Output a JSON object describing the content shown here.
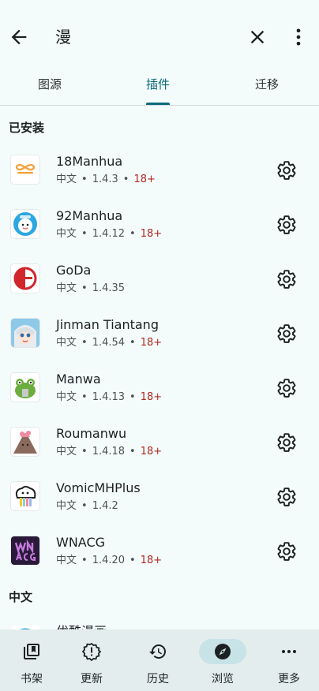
{
  "search": {
    "query": "漫"
  },
  "tabs": [
    {
      "label": "图源"
    },
    {
      "label": "插件"
    },
    {
      "label": "迁移"
    }
  ],
  "sections": {
    "installed": "已安装",
    "chinese": "中文"
  },
  "extensions": [
    {
      "name": "18Manhua",
      "lang": "中文",
      "version": "1.4.3",
      "nsfw": "18+"
    },
    {
      "name": "92Manhua",
      "lang": "中文",
      "version": "1.4.12",
      "nsfw": "18+"
    },
    {
      "name": "GoDa",
      "lang": "中文",
      "version": "1.4.35",
      "nsfw": ""
    },
    {
      "name": "Jinman Tiantang",
      "lang": "中文",
      "version": "1.4.54",
      "nsfw": "18+"
    },
    {
      "name": "Manwa",
      "lang": "中文",
      "version": "1.4.13",
      "nsfw": "18+"
    },
    {
      "name": "Roumanwu",
      "lang": "中文",
      "version": "1.4.18",
      "nsfw": "18+"
    },
    {
      "name": "VomicMHPlus",
      "lang": "中文",
      "version": "1.4.2",
      "nsfw": ""
    },
    {
      "name": "WNACG",
      "lang": "中文",
      "version": "1.4.20",
      "nsfw": "18+"
    }
  ],
  "partial_item": {
    "name": "优酷漫画"
  },
  "bottom_nav": [
    {
      "label": "书架",
      "icon": "library-icon"
    },
    {
      "label": "更新",
      "icon": "updates-icon"
    },
    {
      "label": "历史",
      "icon": "history-icon"
    },
    {
      "label": "浏览",
      "icon": "browse-icon"
    },
    {
      "label": "更多",
      "icon": "more-icon"
    }
  ],
  "colors": {
    "accent": "#0c6b7a",
    "nsfw": "#b3261e",
    "background": "#f4fbfb",
    "nav_bg": "#e4eded"
  }
}
